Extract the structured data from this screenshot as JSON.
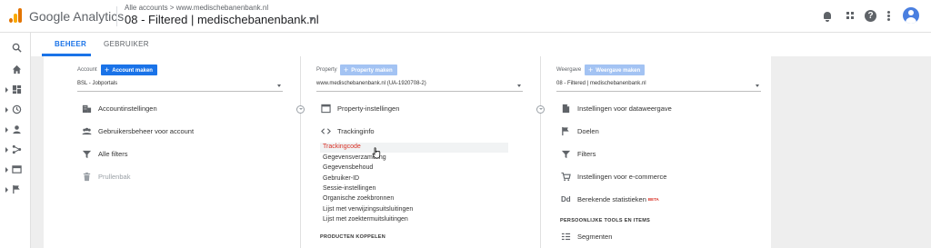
{
  "header": {
    "app_name": "Google Analytics",
    "breadcrumb": "Alle accounts > www.medischebanenbank.nl",
    "view_title": "08 - Filtered | medischebanenbank.nl",
    "help_glyph": "?"
  },
  "tabs": [
    {
      "label": "BEHEER",
      "active": true
    },
    {
      "label": "GEBRUIKER",
      "active": false
    }
  ],
  "account": {
    "label": "Account",
    "create_button": "Account maken",
    "selected": "BSL - Jobportals",
    "items": [
      {
        "label": "Accountinstellingen",
        "icon": "building-icon",
        "disabled": false
      },
      {
        "label": "Gebruikersbeheer voor account",
        "icon": "people-icon",
        "disabled": false
      },
      {
        "label": "Alle filters",
        "icon": "filter-icon",
        "disabled": false
      },
      {
        "label": "Prullenbak",
        "icon": "trash-icon",
        "disabled": true
      }
    ]
  },
  "property": {
    "label": "Property",
    "create_button": "Property maken",
    "selected": "www.medischebanenbank.nl (UA-1920708-2)",
    "items": [
      {
        "label": "Property-instellingen",
        "icon": "window-icon"
      },
      {
        "label": "Trackinginfo",
        "icon": "code-icon"
      }
    ],
    "tracking_sub_items": [
      {
        "label": "Trackingcode",
        "highlighted": true
      },
      {
        "label": "Gegevensverzameling",
        "highlighted": false
      },
      {
        "label": "Gegevensbehoud",
        "highlighted": false
      },
      {
        "label": "Gebruiker-ID",
        "highlighted": false
      },
      {
        "label": "Sessie-instellingen",
        "highlighted": false
      },
      {
        "label": "Organische zoekbronnen",
        "highlighted": false
      },
      {
        "label": "Lijst met verwijzingsuitsluitingen",
        "highlighted": false
      },
      {
        "label": "Lijst met zoektermuitsluitingen",
        "highlighted": false
      }
    ],
    "section_heading": "PRODUCTEN KOPPELEN"
  },
  "view": {
    "label": "Weergave",
    "create_button": "Weergave maken",
    "selected": "08 - Filtered | medischebanenbank.nl",
    "items": [
      {
        "label": "Instellingen voor dataweergave",
        "icon": "document-icon"
      },
      {
        "label": "Doelen",
        "icon": "flag-icon"
      },
      {
        "label": "Filters",
        "icon": "filter-icon"
      },
      {
        "label": "Instellingen voor e-commerce",
        "icon": "cart-icon"
      },
      {
        "label": "Berekende statistieken",
        "icon": "dd-icon",
        "icon_text": "Dd",
        "badge": "BETA"
      }
    ],
    "section_heading": "PERSOONLIJKE TOOLS EN ITEMS",
    "personal_items": [
      {
        "label": "Segmenten",
        "icon": "segments-icon"
      }
    ]
  },
  "colors": {
    "accent": "#1a73e8",
    "highlight_text": "#d93025"
  }
}
